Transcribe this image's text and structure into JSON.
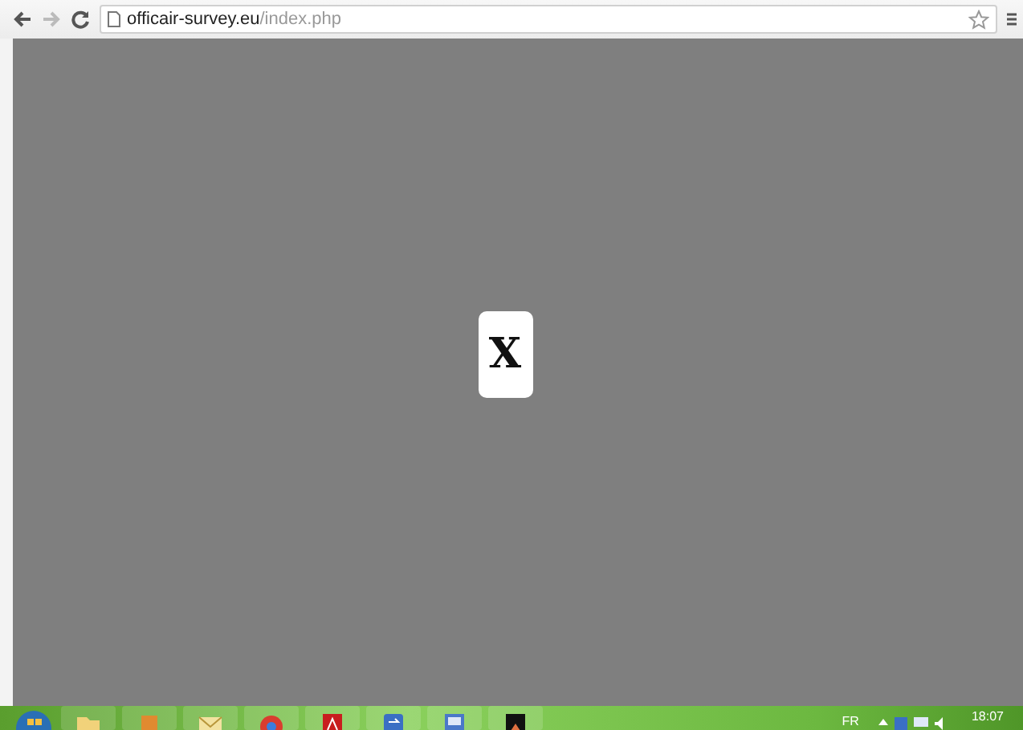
{
  "browser": {
    "address": {
      "host": "officair-survey.eu",
      "path": "/index.php"
    }
  },
  "page": {
    "close_button": {
      "label": "X"
    }
  },
  "taskbar": {
    "language": "FR",
    "clock": "18:07"
  }
}
